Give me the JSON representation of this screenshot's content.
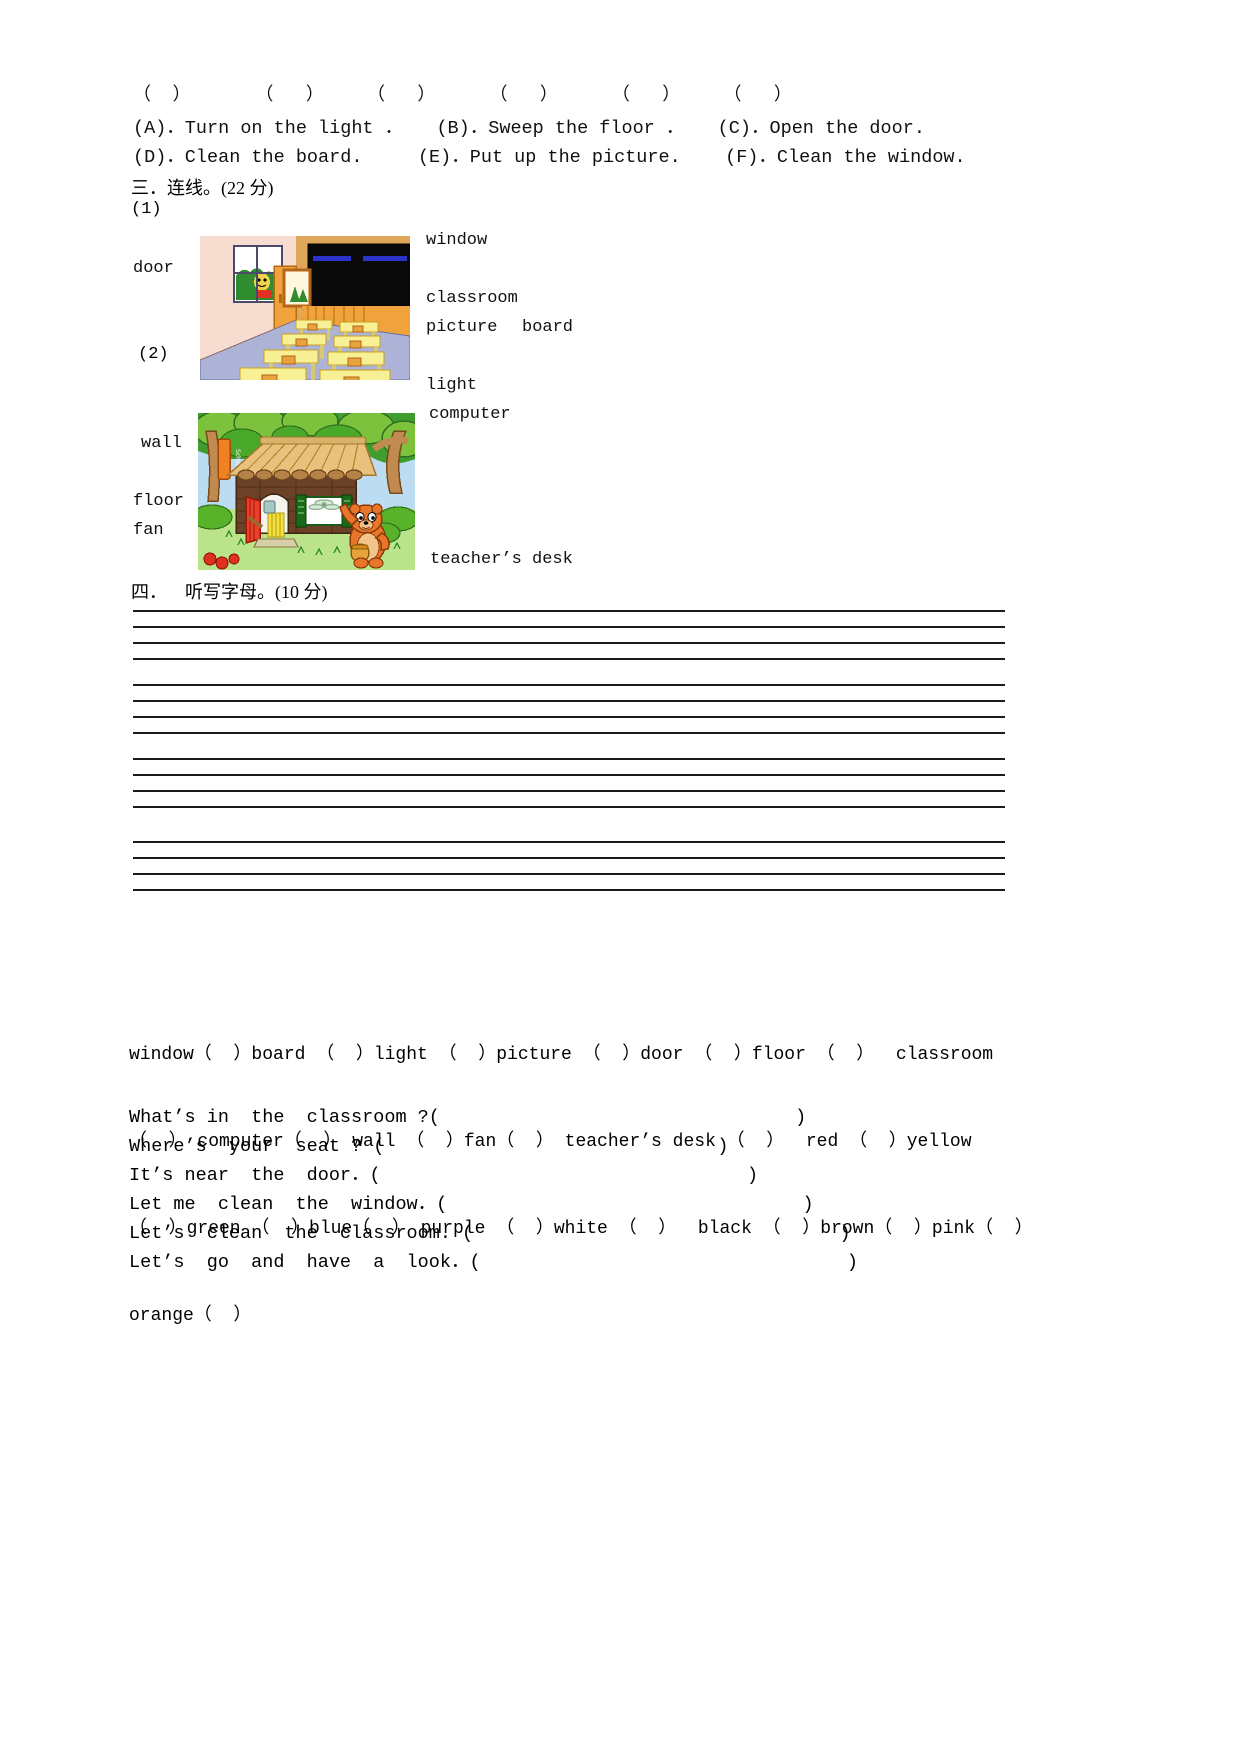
{
  "section_two": {
    "bracket_row": "（  ）      （   ）    （   ）     （   ）     （   ）    （   ）",
    "options_line_1": "(A)．Turn on the light ．   (B)．Sweep the floor ．   (C)．Open the door.",
    "options_line_2": "(D)．Clean the board.     (E)．Put up the picture.    (F)．Clean the window."
  },
  "section_three": {
    "heading": "三．连线。(22 分)",
    "item_1_number": "(1)",
    "item_2_number": "(2)",
    "left_labels_1": [
      "door"
    ],
    "right_labels_1": [
      "window",
      "classroom",
      "picture",
      "board"
    ],
    "left_labels_2": [
      "wall",
      "floor",
      "fan"
    ],
    "right_labels_2": [
      "light",
      "computer",
      "teacher’s desk"
    ],
    "classroom_image_alt": "classroom interior with desks, blackboard, window and door",
    "cottage_image_alt": "log cabin school in forest with bear and School sign",
    "cottage_sign_text": "School"
  },
  "section_four": {
    "heading": "四．    听写字母。(10 分)",
    "line_groups": 4,
    "lines_per_group": 4
  },
  "word_bank": {
    "lines": [
      "window（  ）board （  ）light （  ）picture （  ）door （  ）floor （  ）  classroom",
      "（  ） computer（  ） wall （  ）fan（  ） teacher’s desk （  ）  red （  ）yellow",
      "（  ）green （  ）blue（  ） purple （  ）white （  ）  black （  ）brown（  ）pink（  ）",
      "orange（  ）"
    ]
  },
  "translation_sentences": [
    "What’s in  the  classroom ?(                                )",
    "Where’s  your  seat ? (                              )",
    "It’s near  the  door．(                                 )",
    "Let me  clean  the  window．(                                )",
    "Let’s  clean  the  classroom. (                                 )",
    "Let’s  go  and  have  a  look．(                                 )"
  ],
  "colors": {
    "ink": "#111111",
    "rule": "#1a1a1a",
    "wall_pink": "#f7dcd0",
    "floor_blue": "#adb3d6",
    "desk_yellow": "#f7f094",
    "desk_yellow_dark": "#e8d96a",
    "board_black": "#0a0a0a",
    "door_orange": "#f0a33c",
    "wood_tan": "#e8b878",
    "sky_blue": "#bcdcf2",
    "leaf_green": "#7cc23c",
    "leaf_dark": "#2f8c2f",
    "grass_green": "#bbe38a",
    "cabin_brown": "#6b4228",
    "roof_tan": "#e8c27c",
    "bear_orange": "#e8762a",
    "door_red": "#e8402a",
    "sign_orange": "#f08020"
  }
}
